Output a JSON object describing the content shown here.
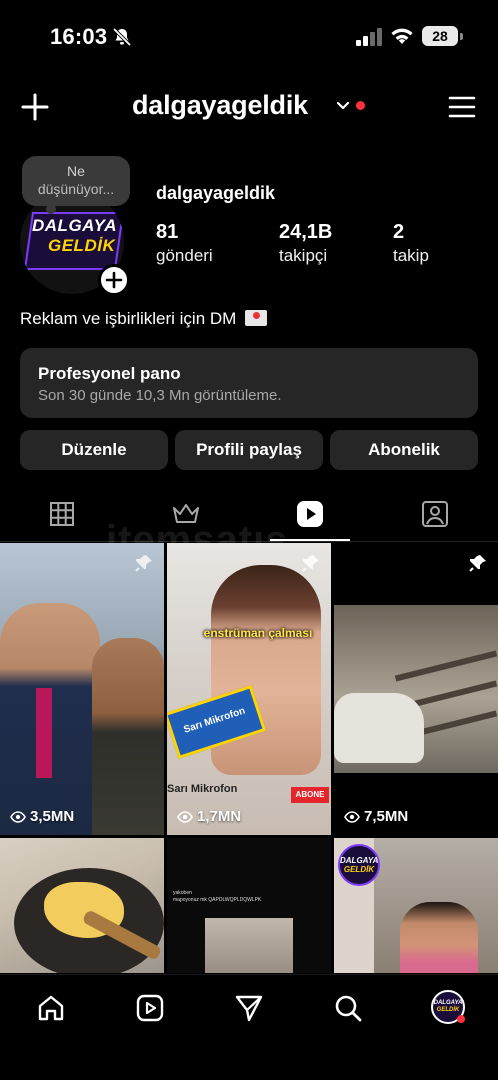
{
  "status_bar": {
    "time": "16:03",
    "battery": "28",
    "icons": [
      "bell-muted-icon",
      "signal-icon",
      "wifi-icon",
      "battery-icon"
    ]
  },
  "header": {
    "username": "dalgayageldik",
    "icons": [
      "plus-icon",
      "chevron-down-icon",
      "notification-dot",
      "menu-icon"
    ],
    "dot_color": "#ff3040"
  },
  "profile": {
    "note_line1": "Ne",
    "note_line2": "düşünüyor...",
    "avatar_text_line1": "DALGAYA",
    "avatar_text_line2": "GELDİK",
    "name": "dalgayageldik",
    "stats": [
      {
        "value": "81",
        "label": "gönderi"
      },
      {
        "value": "24,1B",
        "label": "takipçi"
      },
      {
        "value": "2",
        "label": "takip"
      }
    ],
    "bio": "Reklam ve işbirlikleri için DM"
  },
  "dashboard": {
    "title": "Profesyonel pano",
    "subtitle": "Son 30 günde 10,3 Mn görüntüleme."
  },
  "actions": {
    "edit": "Düzenle",
    "share": "Profili paylaş",
    "subscribe": "Abonelik"
  },
  "tabs": {
    "items": [
      "grid-tab",
      "reels-like-tab",
      "reels-tab",
      "tagged-tab"
    ],
    "active": "reels-tab"
  },
  "watermark": "itemsatış",
  "grid": {
    "items": [
      {
        "views": "3,5MN",
        "pinned": true
      },
      {
        "views": "1,7MN",
        "pinned": true,
        "caption": "enstrüman çalması",
        "mic_label": "Sarı Mikrofon",
        "source": "Sarı Mikrofon",
        "cta": "ABONE"
      },
      {
        "views": "7,5MN",
        "pinned": true
      },
      {
        "views": "",
        "pinned": false
      },
      {
        "views": "",
        "pinned": false,
        "tweet_user": "yakoben",
        "tweet_text": "mapoyonuz mk QAPDLWQPLDQWLPK"
      },
      {
        "views": "",
        "pinned": false,
        "badge_line1": "DALGAYA",
        "badge_line2": "GELDİK"
      }
    ]
  },
  "bottom_nav": {
    "items": [
      "home-icon",
      "reels-icon",
      "send-icon",
      "search-icon",
      "profile-avatar"
    ],
    "avatar_line1": "DALGAYA",
    "avatar_line2": "GELDİK"
  },
  "colors": {
    "background": "#000000",
    "surface": "#262626",
    "accent_red": "#ff3040",
    "brand_yellow": "#ffd400",
    "brand_purple": "#7c3cff"
  }
}
